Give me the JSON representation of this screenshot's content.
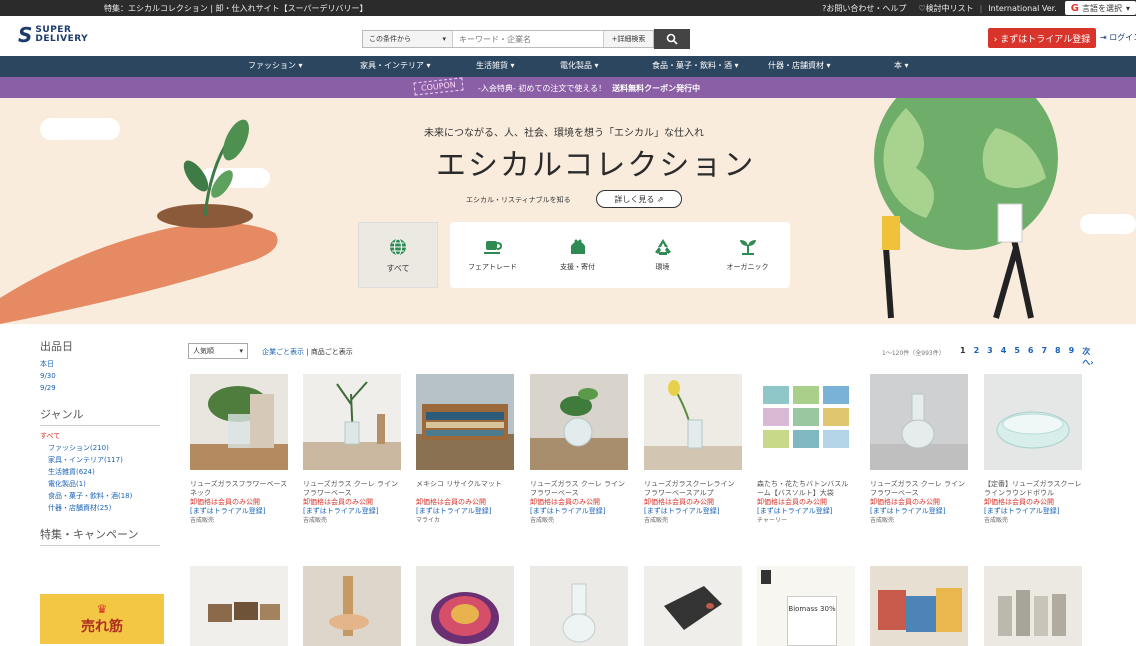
{
  "topbar": {
    "title": "特集：エシカルコレクション | 卸・仕入れサイト【スーパーデリバリー】",
    "help": "?お問い合わせ・ヘルプ",
    "wishlist": "♡検討中リスト",
    "international": "International Ver.",
    "translate": "言語を選択"
  },
  "header": {
    "logo_top": "SUPER",
    "logo_bottom": "DELIVERY",
    "search_scope": "この条件から",
    "search_placeholder": "キーワード・企業名",
    "search_advanced": "+詳細検索",
    "trial_button": "› まずはトライアル登録",
    "login": "ログイン"
  },
  "nav": [
    {
      "label": "ファッション ▾"
    },
    {
      "label": "家具・インテリア ▾"
    },
    {
      "label": "生活雑貨 ▾"
    },
    {
      "label": "電化製品 ▾"
    },
    {
      "label": "食品・菓子・飲料・酒 ▾"
    },
    {
      "label": "什器・店舗資材 ▾"
    },
    {
      "label": "本 ▾"
    }
  ],
  "coupon": {
    "tag": "COUPON",
    "text": "-入会特典- 初めての注文で使える！",
    "bold": "送料無料クーポン発行中"
  },
  "banner": {
    "tagline": "未来につながる、人、社会、環境を想う「エシカル」な仕入れ",
    "title": "エシカルコレクション",
    "subtitle": "エシカル・リスティナブルを知る",
    "more": "詳しく見る ⇗",
    "all_label": "すべて",
    "categories": [
      {
        "label": "フェアトレード",
        "icon": "cup-icon"
      },
      {
        "label": "支援・寄付",
        "icon": "purse-icon"
      },
      {
        "label": "環境",
        "icon": "recycle-icon"
      },
      {
        "label": "オーガニック",
        "icon": "sprout-icon"
      }
    ]
  },
  "sidebar": {
    "date_heading": "出品日",
    "dates": [
      "本日",
      "9/30",
      "9/29"
    ],
    "genre_heading": "ジャンル",
    "genres": [
      {
        "label": "すべて",
        "active": true
      },
      {
        "label": "ファッション(210)"
      },
      {
        "label": "家具・インテリア(117)"
      },
      {
        "label": "生活雑貨(624)"
      },
      {
        "label": "電化製品(1)"
      },
      {
        "label": "食品・菓子・飲料・酒(18)"
      },
      {
        "label": "什器・店舗資材(25)"
      }
    ],
    "campaign_heading": "特集・キャンペーン",
    "bestseller": "売れ筋"
  },
  "toolbar": {
    "sort": "人気順",
    "view_company": "企業ごと表示",
    "view_separator": " | ",
    "view_product": "商品ごと表示",
    "results": "1～120件（全993件）",
    "pages": [
      "1",
      "2",
      "3",
      "4",
      "5",
      "6",
      "7",
      "8",
      "9",
      "次へ›"
    ]
  },
  "products": [
    {
      "name": "リューズガラスフラワーベースネック",
      "price": "卸価格は会員のみ公開",
      "trial": "[まずはトライアル登録]",
      "shop": "吉成販売"
    },
    {
      "name": "リューズガラス クーレ ライン フラワーベース",
      "price": "卸価格は会員のみ公開",
      "trial": "[まずはトライアル登録]",
      "shop": "吉成販売"
    },
    {
      "name": "メキシコ リサイクルマット",
      "price": "卸価格は会員のみ公開",
      "trial": "[まずはトライアル登録]",
      "shop": "マライカ"
    },
    {
      "name": "リューズガラス クーレ ライン フラワーベース",
      "price": "卸価格は会員のみ公開",
      "trial": "[まずはトライアル登録]",
      "shop": "吉成販売"
    },
    {
      "name": "リューズガラスクーレライン フラワーベースアルプ",
      "price": "卸価格は会員のみ公開",
      "trial": "[まずはトライアル登録]",
      "shop": "吉成販売"
    },
    {
      "name": "森たち・花たちバトンバスルーム【バスソルト】大袋",
      "price": "卸価格は会員のみ公開",
      "trial": "[まずはトライアル登録]",
      "shop": "チャーリー"
    },
    {
      "name": "リューズガラス クーレ ライン フラワーベース",
      "price": "卸価格は会員のみ公開",
      "trial": "[まずはトライアル登録]",
      "shop": "吉成販売"
    },
    {
      "name": "【定番】リューズガラスクーレラインラウンドボウル",
      "price": "卸価格は会員のみ公開",
      "trial": "[まずはトライアル登録]",
      "shop": "吉成販売"
    }
  ],
  "product_row2_label": "Biomass 30%",
  "colors": {
    "nav": "#2d4660",
    "coupon": "#8b5fa6",
    "accent_red": "#d9342b",
    "link_blue": "#1a62b8",
    "banner_bg": "#f9ecdc"
  }
}
